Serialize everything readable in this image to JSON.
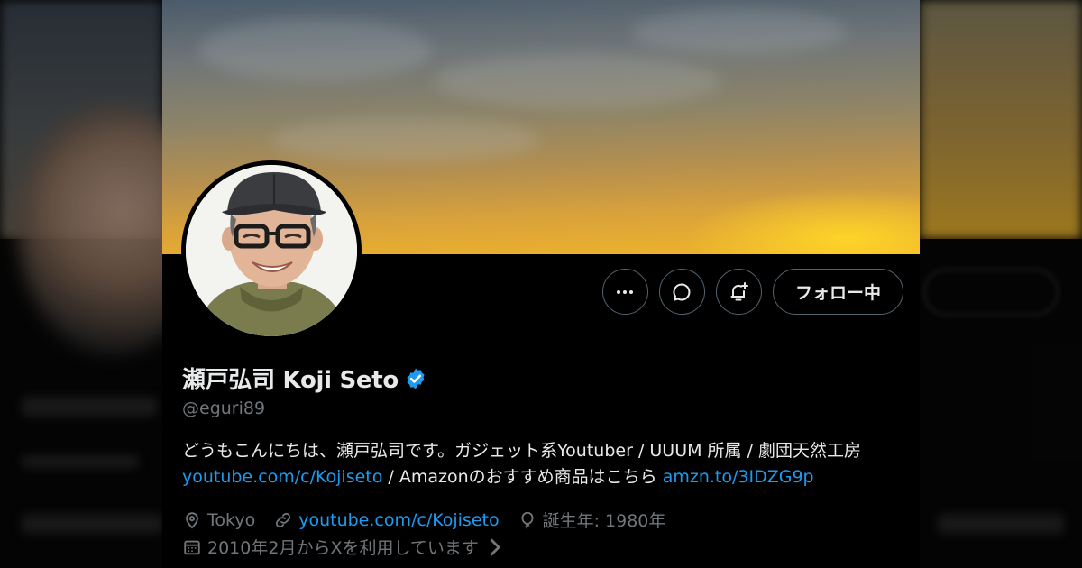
{
  "profile": {
    "display_name": "瀬戸弘司 Koji Seto",
    "handle": "@eguri89",
    "bio_text_1": "どうもこんにちは、瀬戸弘司です。ガジェット系Youtuber / UUUM 所属 / 劇団天然工房 ",
    "bio_link_1": "youtube.com/c/Kojiseto",
    "bio_text_2": " / Amazonのおすすめ商品はこちら ",
    "bio_link_2": "amzn.to/3IDZG9p",
    "location": "Tokyo",
    "website": "youtube.com/c/Kojiseto",
    "birth": "誕生年: 1980年",
    "joined": "2010年2月からXを利用しています"
  },
  "actions": {
    "follow_label": "フォロー中"
  },
  "icons": {
    "more": "more-horizontal-icon",
    "message": "message-icon",
    "notify": "bell-plus-icon",
    "verified": "verified-badge-icon",
    "location": "location-pin-icon",
    "link": "link-icon",
    "birthday": "balloon-icon",
    "calendar": "calendar-icon",
    "chevron": "chevron-right-icon"
  },
  "colors": {
    "link": "#1d9bf0",
    "secondary_text": "#71767b",
    "border": "#536471",
    "verified": "#1d9bf0"
  }
}
